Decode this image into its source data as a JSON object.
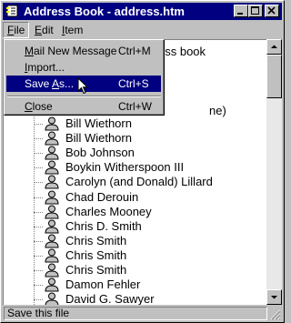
{
  "window": {
    "title": "Address Book - address.htm"
  },
  "menubar": {
    "items": [
      {
        "label": "File"
      },
      {
        "label": "Edit"
      },
      {
        "label": "Item"
      }
    ]
  },
  "file_menu": {
    "items": [
      {
        "label": "Mail New Message",
        "shortcut": "Ctrl+M"
      },
      {
        "label": "Import...",
        "shortcut": ""
      },
      {
        "label": "Save As...",
        "shortcut": "Ctrl+S"
      },
      {
        "label": "Close",
        "shortcut": "Ctrl+W"
      }
    ]
  },
  "tree": {
    "root_fragment": "ess book",
    "partial_fragment": "ne)",
    "entries": [
      "Bill Wiethorn",
      "Bill Wiethorn",
      "Bob Johnson",
      "Boykin Witherspoon III",
      "Carolyn (and Donald) Lillard",
      "Chad Derouin",
      "Charles Mooney",
      "Chris D. Smith",
      "Chris Smith",
      "Chris Smith",
      "Chris Smith",
      "Damon Fehler",
      "David G. Sawyer"
    ]
  },
  "status": {
    "text": "Save this file"
  }
}
